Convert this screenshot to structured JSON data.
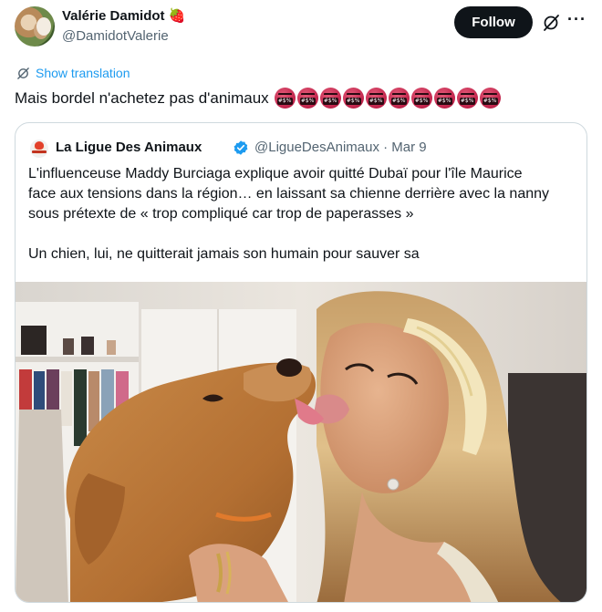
{
  "author": {
    "name": "Valérie Damidot",
    "name_emoji": "🍓",
    "handle": "@DamidotValerie"
  },
  "actions": {
    "follow_label": "Follow",
    "grok_icon": "grok-slash-icon",
    "more_icon": "more-horizontal-icon",
    "more_glyph": "···"
  },
  "translation": {
    "label": "Show translation",
    "icon": "translate-icon"
  },
  "tweet": {
    "text": "Mais bordel n'achetez pas d'animaux",
    "emoji_icon": "face-with-symbols-on-mouth-icon",
    "emoji_count": 10
  },
  "quoted": {
    "name": "La Ligue Des Animaux",
    "verified_icon": "verified-badge-icon",
    "handle_and_date": "@LigueDesAnimaux · Mar 9",
    "lines": [
      "L'influenceuse Maddy Burciaga explique avoir quitté Dubaï pour l'île Maurice",
      "face aux tensions dans la région… en laissant sa chienne derrière avec la nanny",
      "sous prétexte de « trop compliqué car trop de paperasses »",
      "",
      "Un chien, lui, ne quitterait jamais son humain pour sauver sa"
    ]
  },
  "colors": {
    "link_blue": "#1d9bf0",
    "text_primary": "#0f1419",
    "text_secondary": "#536471",
    "border": "#cfd9de",
    "follow_bg": "#0f1419"
  }
}
